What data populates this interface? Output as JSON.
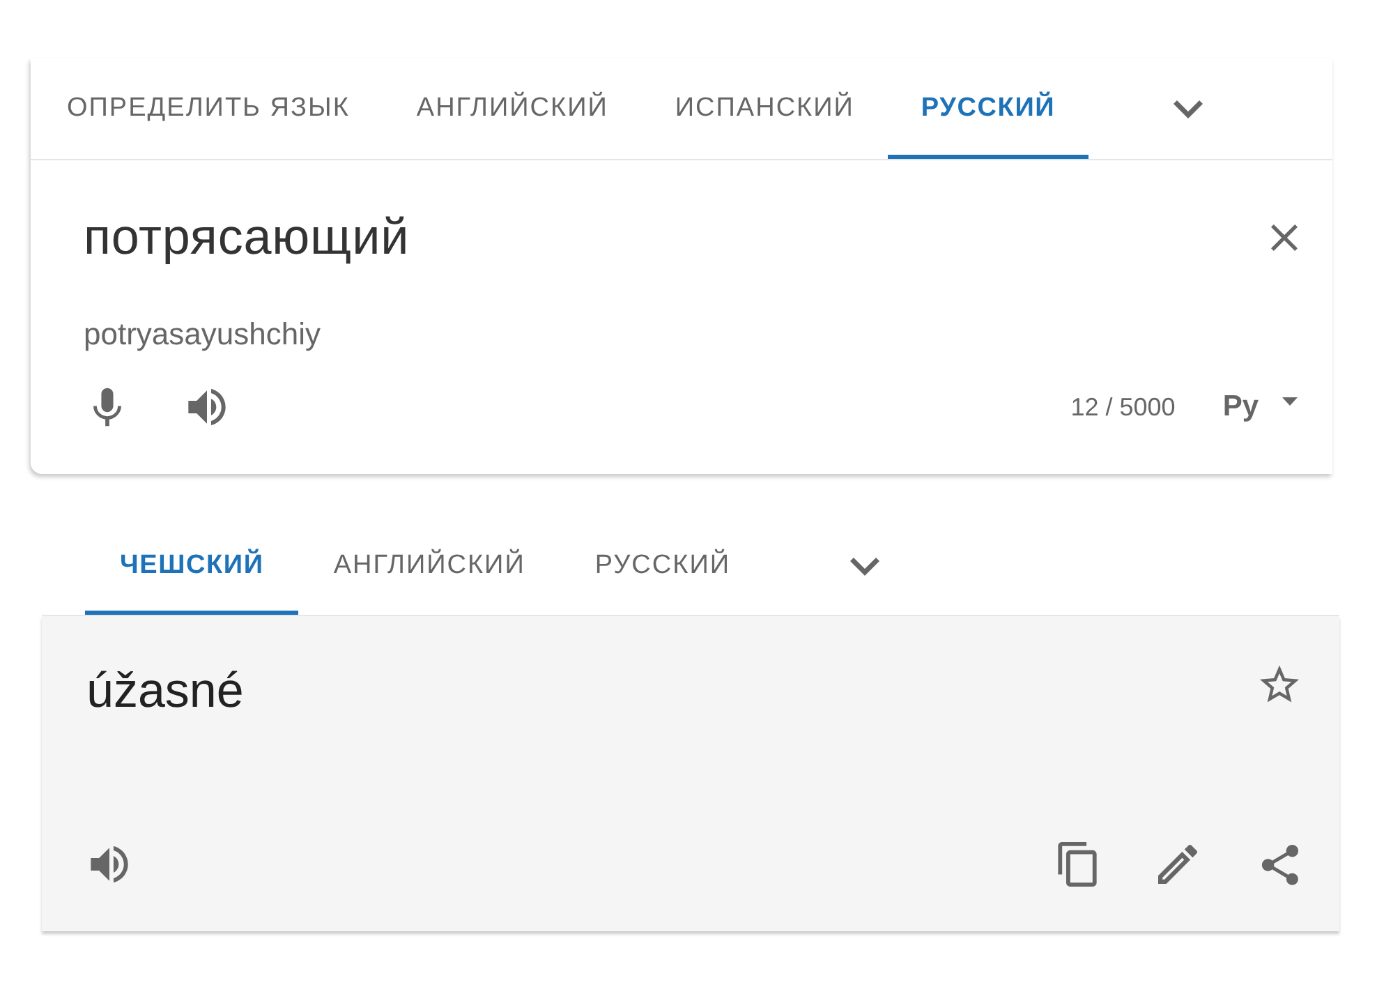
{
  "source_tabs": [
    {
      "label": "ОПРЕДЕЛИТЬ ЯЗЫК",
      "selected": false
    },
    {
      "label": "АНГЛИЙСКИЙ",
      "selected": false
    },
    {
      "label": "ИСПАНСКИЙ",
      "selected": false
    },
    {
      "label": "РУССКИЙ",
      "selected": true
    }
  ],
  "source": {
    "text": "потрясающий",
    "transliteration": "potryasayushchiy",
    "char_count": "12 / 5000",
    "input_tool": "Ру"
  },
  "target_tabs": [
    {
      "label": "ЧЕШСКИЙ",
      "selected": true
    },
    {
      "label": "АНГЛИЙСКИЙ",
      "selected": false
    },
    {
      "label": "РУССКИЙ",
      "selected": false
    }
  ],
  "translation": {
    "text": "úžasné",
    "starred": false
  }
}
